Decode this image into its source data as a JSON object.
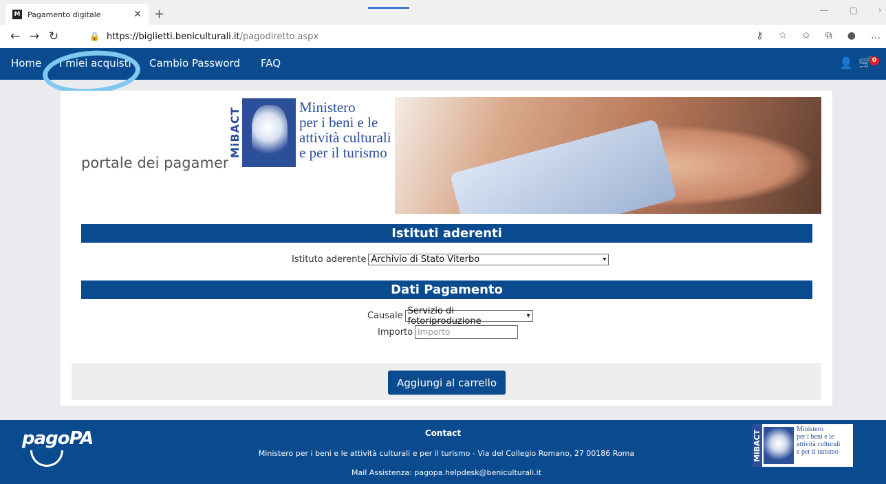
{
  "browser": {
    "tab_title": "Pagamento digitale",
    "favicon_text": "M",
    "url_host": "https://biglietti.beniculturali.it",
    "url_path": "/pagodiretto.aspx"
  },
  "nav": {
    "home": "Home",
    "purchases": "I miei acquisti",
    "change_password": "Cambio Password",
    "faq": "FAQ",
    "cart_count": "0"
  },
  "banner": {
    "portale": "portale dei pagamenti",
    "mibact": "MiBACT",
    "ministero_lines": [
      "Ministero",
      "per i beni e le",
      "attività culturali",
      "e per il turismo"
    ]
  },
  "istituti": {
    "heading": "Istituti aderenti",
    "label": "Istituto aderente",
    "selected": "Archivio di Stato Viterbo"
  },
  "pagamento": {
    "heading": "Dati Pagamento",
    "causale_label": "Causale",
    "causale_selected": "Servizio di fotoriproduzione",
    "importo_label": "Importo",
    "importo_placeholder": "Importo",
    "add_button": "Aggiungi al carrello"
  },
  "footer": {
    "pagopa": "pagoPA",
    "contact": "Contact",
    "address": "Ministero per i beni e le attività culturali e per il turismo - Via del Collegio Romano, 27 00186 Roma",
    "mail": "Mail Assistenza: pagopa.helpdesk@beniculturali.it",
    "logo_vertical": "MiBACT",
    "logo_lines": [
      "Ministero",
      "per i beni e le",
      "attività culturali",
      "e per il turismo"
    ]
  },
  "colors": {
    "brand_blue": "#0a4b8f",
    "annotation": "#7fc8f0"
  },
  "icons": [
    "back-icon",
    "forward-icon",
    "refresh-icon",
    "lock-icon",
    "user-icon",
    "cart-icon",
    "chevron-down-icon"
  ]
}
